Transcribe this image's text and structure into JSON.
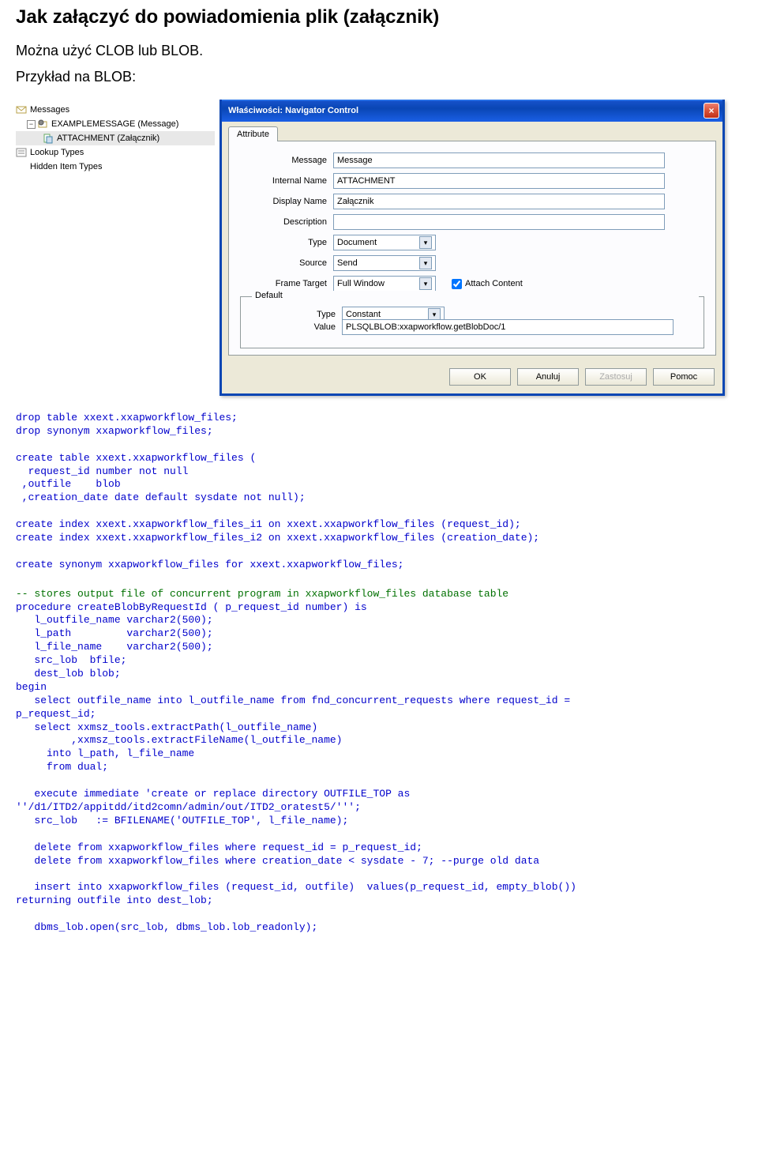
{
  "heading": "Jak załączyć do powiadomienia plik (załącznik)",
  "intro": "Można użyć CLOB lub BLOB.",
  "sub": "Przykład na BLOB:",
  "tree": {
    "items": [
      {
        "label": "Messages",
        "icon": "envelope"
      },
      {
        "label": "EXAMPLEMESSAGE (Message)",
        "icon": "gear-envelope",
        "indent": 1,
        "expander": "−"
      },
      {
        "label": "ATTACHMENT (Załącznik)",
        "icon": "attachment",
        "indent": 2,
        "selected": true
      },
      {
        "label": "Lookup Types",
        "icon": "list"
      },
      {
        "label": "Hidden Item Types",
        "icon": "blank"
      }
    ]
  },
  "dialog": {
    "title": "Właściwości: Navigator Control",
    "close": "×",
    "tab": "Attribute",
    "fields": {
      "message_label": "Message",
      "message_value": "Message",
      "internal_label": "Internal Name",
      "internal_value": "ATTACHMENT",
      "display_label": "Display Name",
      "display_value": "Załącznik",
      "description_label": "Description",
      "description_value": "",
      "type_label": "Type",
      "type_value": "Document",
      "source_label": "Source",
      "source_value": "Send",
      "frame_label": "Frame Target",
      "frame_value": "Full Window",
      "attach_label": "Attach Content",
      "default_legend": "Default",
      "dtype_label": "Type",
      "dtype_value": "Constant",
      "value_label": "Value",
      "value_value": "PLSQLBLOB:xxapworkflow.getBlobDoc/1"
    },
    "buttons": {
      "ok": "OK",
      "cancel": "Anuluj",
      "apply": "Zastosuj",
      "help": "Pomoc"
    }
  },
  "code1": "drop table xxext.xxapworkflow_files;\ndrop synonym xxapworkflow_files;\n\ncreate table xxext.xxapworkflow_files (\n  request_id number not null\n ,outfile    blob\n ,creation_date date default sysdate not null);\n\ncreate index xxext.xxapworkflow_files_i1 on xxext.xxapworkflow_files (request_id);\ncreate index xxext.xxapworkflow_files_i2 on xxext.xxapworkflow_files (creation_date);\n\ncreate synonym xxapworkflow_files for xxext.xxapworkflow_files;",
  "code2_comment": "-- stores output file of concurrent program in xxapworkflow_files database table",
  "code2a": "procedure createBlobByRequestId ( p_request_id number) is\n   l_outfile_name varchar2(500);\n   l_path         varchar2(500);\n   l_file_name    varchar2(500);\n   src_lob  bfile;\n   dest_lob blob;\nbegin\n   select outfile_name into l_outfile_name from fnd_concurrent_requests where request_id =\np_request_id;\n   select xxmsz_tools.extractPath(l_outfile_name)\n         ,xxmsz_tools.extractFileName(l_outfile_name)\n     into l_path, l_file_name\n     from dual;",
  "code2b": "   execute immediate 'create or replace directory OUTFILE_TOP as\n''/d1/ITD2/appitdd/itd2comn/admin/out/ITD2_oratest5/''';\n   src_lob   := BFILENAME('OUTFILE_TOP', l_file_name);\n\n   delete from xxapworkflow_files where request_id = p_request_id;\n   delete from xxapworkflow_files where creation_date < sysdate - 7; --purge old data\n\n   insert into xxapworkflow_files (request_id, outfile)  values(p_request_id, empty_blob())\nreturning outfile into dest_lob;\n\n   dbms_lob.open(src_lob, dbms_lob.lob_readonly);"
}
